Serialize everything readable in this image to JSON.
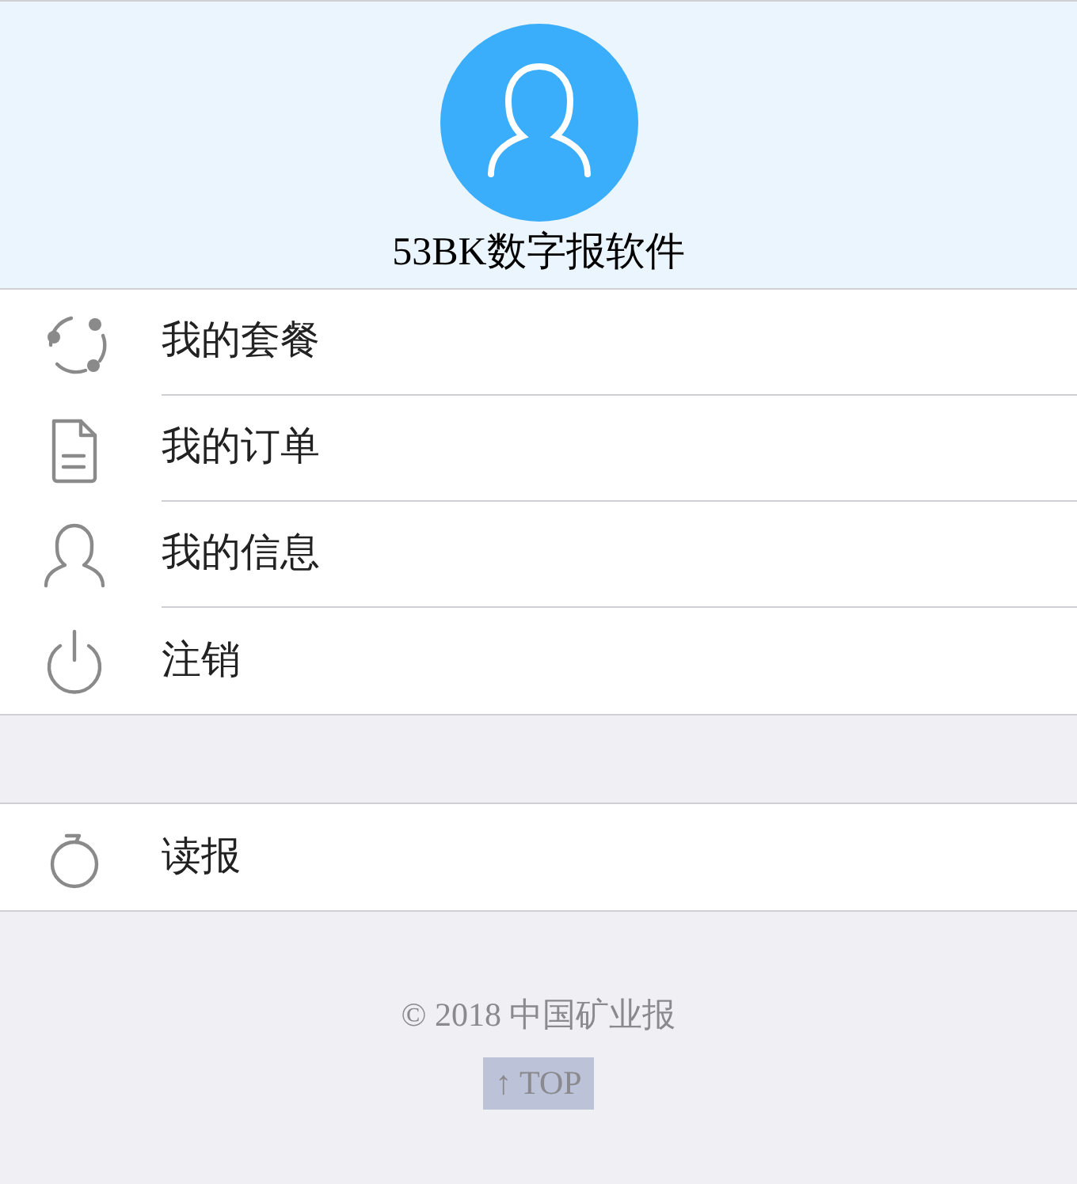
{
  "header": {
    "title": "53BK数字报软件"
  },
  "menu": [
    {
      "kind": "share",
      "label": "我的套餐"
    },
    {
      "kind": "document",
      "label": "我的订单"
    },
    {
      "kind": "user",
      "label": "我的信息"
    },
    {
      "kind": "power",
      "label": "注销"
    }
  ],
  "menu_2": [
    {
      "kind": "timer",
      "label": "读报"
    }
  ],
  "footer": {
    "copyright": "© 2018 中国矿业报",
    "top_button": "↑ TOP"
  }
}
